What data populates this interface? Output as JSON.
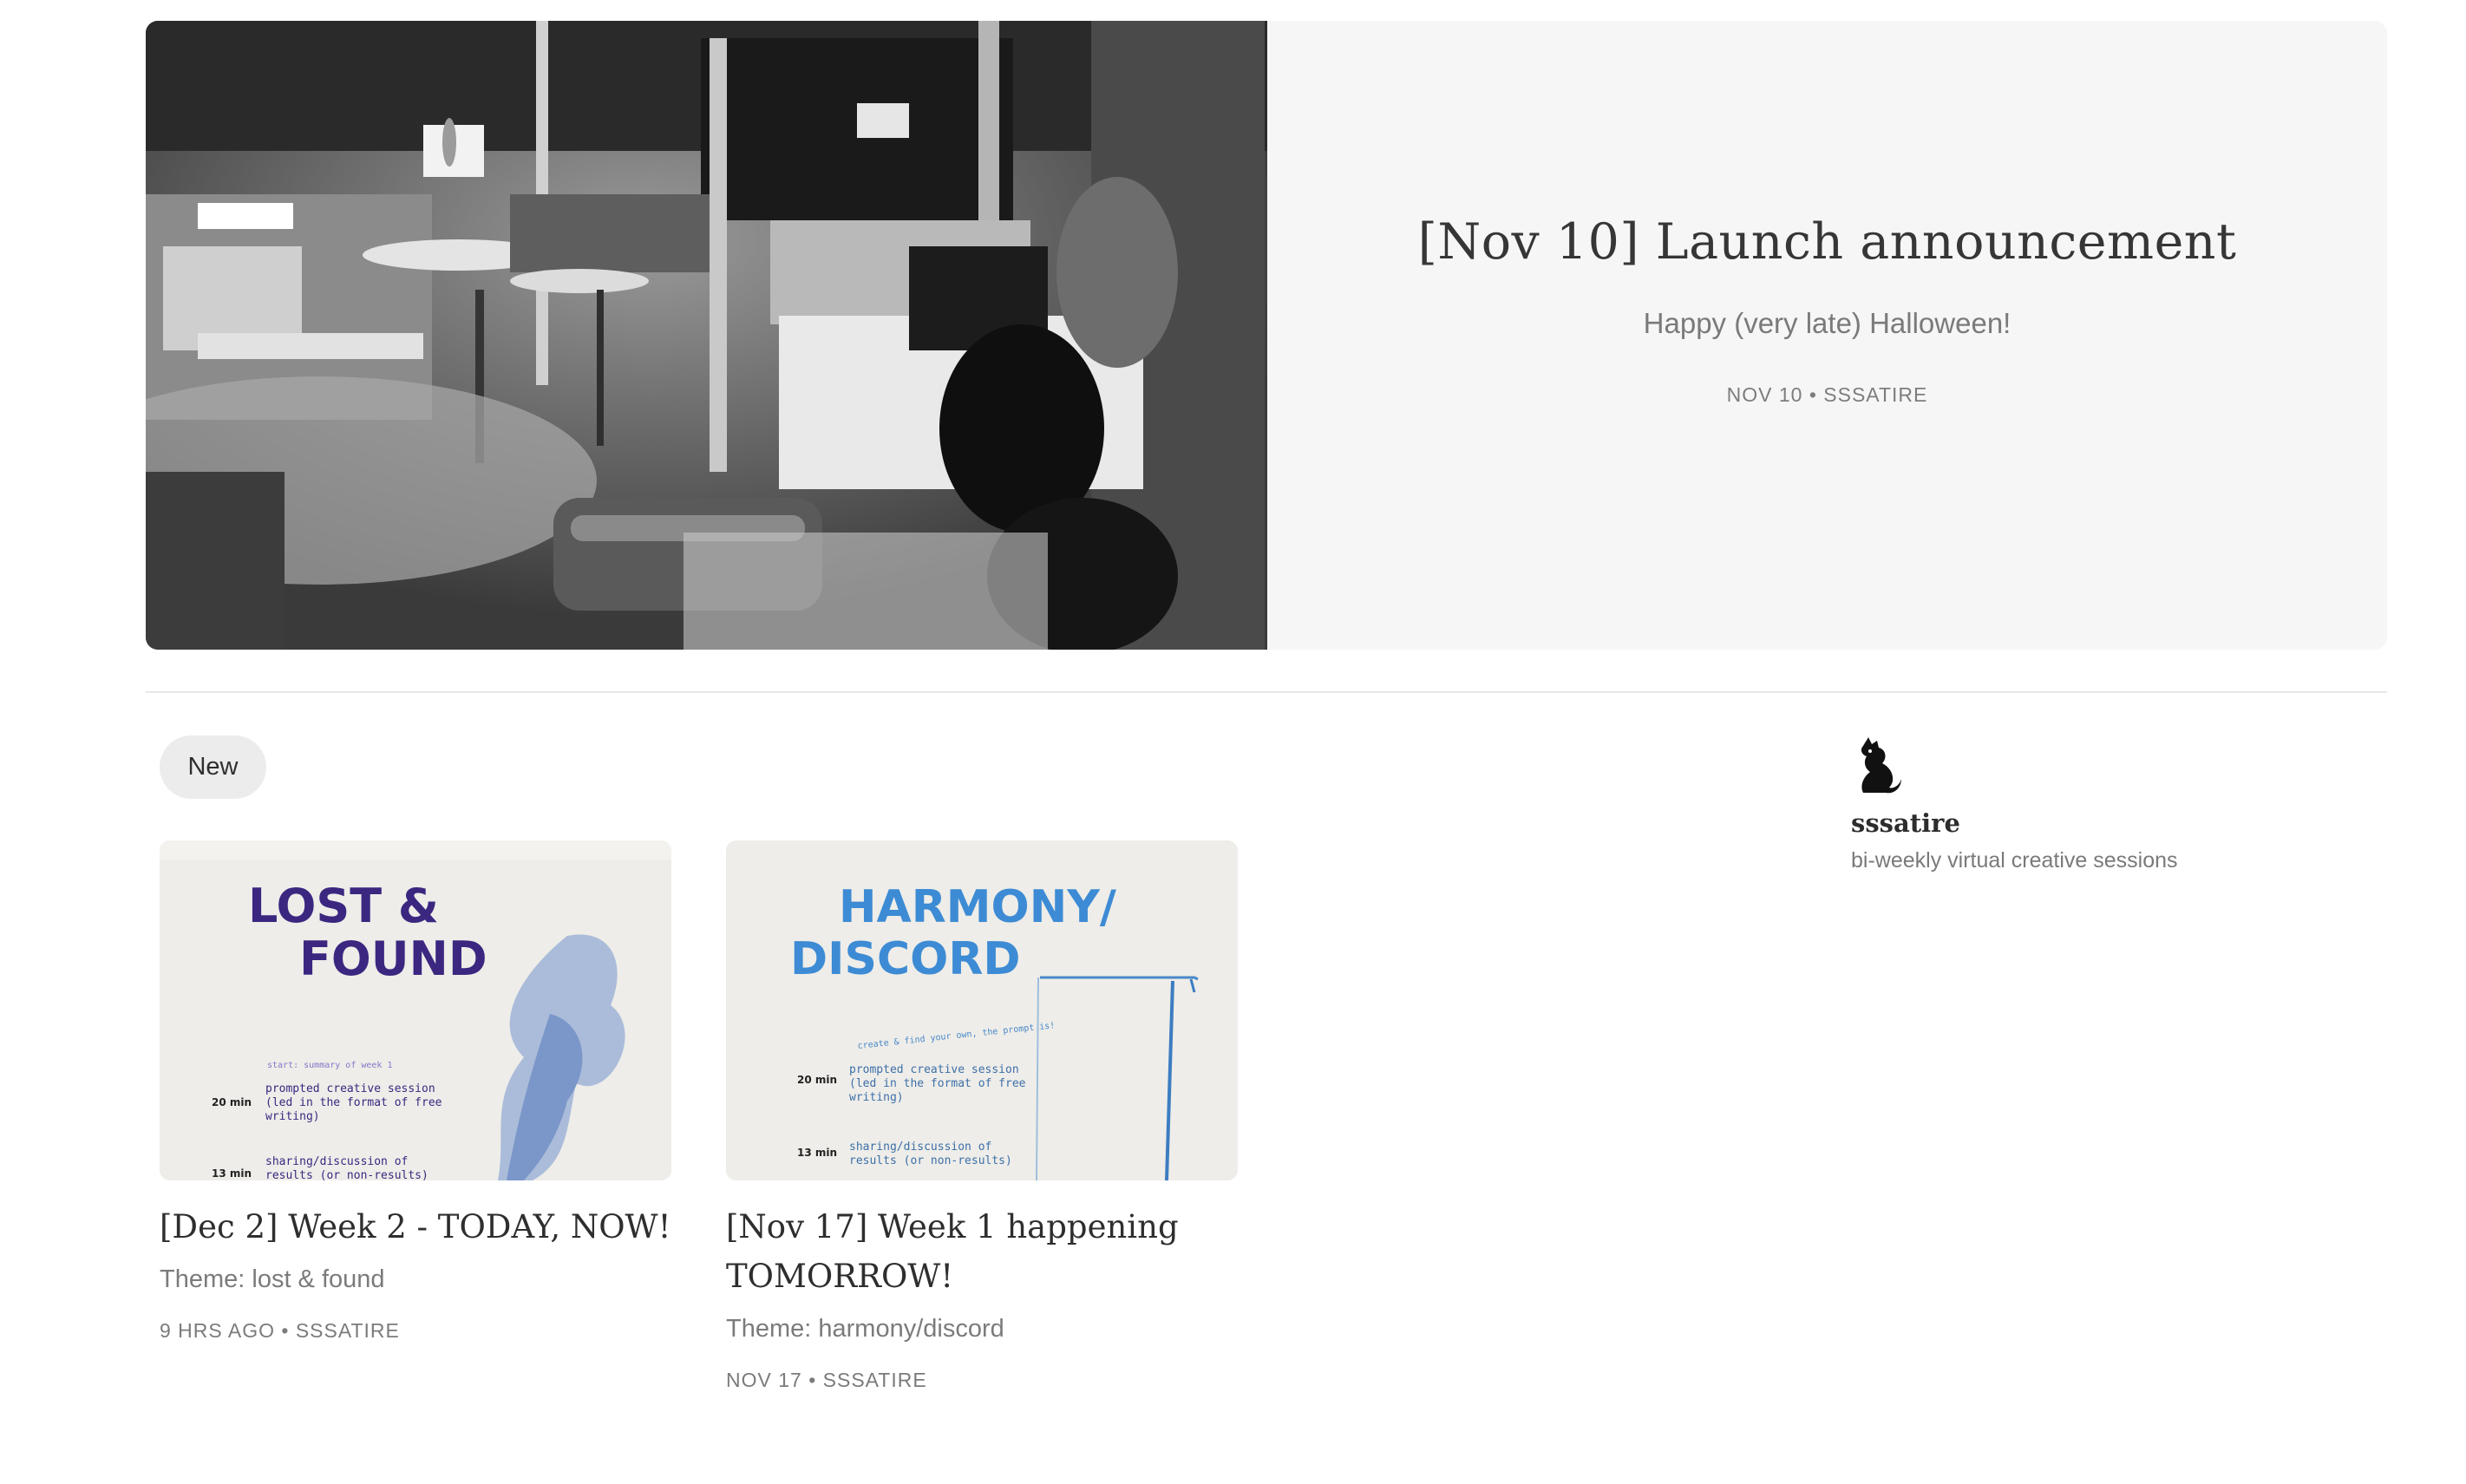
{
  "featured": {
    "title": "[Nov 10] Launch announcement",
    "subtitle": "Happy (very late) Halloween!",
    "meta": "NOV 10 • SSSATIRE",
    "image": "grayscale-painted-cafe-interior-photo"
  },
  "filters": {
    "active_label": "New"
  },
  "posts": [
    {
      "title": "[Dec 2] Week 2 - TODAY, NOW!",
      "subtitle": "Theme: lost & found",
      "meta": "9 HRS AGO • SSSATIRE",
      "thumbnail": {
        "heading_line1": "LOST &",
        "heading_line2": "FOUND",
        "heading_color": "#3b2780",
        "small_note": "start: summary of week 1",
        "rows": [
          {
            "time": "20 min",
            "lines": [
              "prompted creative session",
              "(led in the format of free",
              "writing)"
            ]
          },
          {
            "time": "13 min",
            "lines": [
              "sharing/discussion of",
              "results (or non-results)"
            ]
          }
        ]
      }
    },
    {
      "title": "[Nov 17] Week 1 happening TOMORROW!",
      "subtitle": "Theme: harmony/discord",
      "meta": "NOV 17 • SSSATIRE",
      "thumbnail": {
        "heading_line1": "HARMONY/",
        "heading_line2": "DISCORD",
        "heading_color": "#3d8bd4",
        "small_note": "create & find your own, the prompt is!",
        "rows": [
          {
            "time": "20 min",
            "lines": [
              "prompted creative session",
              "(led in the format of free",
              "writing)"
            ]
          },
          {
            "time": "13 min",
            "lines": [
              "sharing/discussion of",
              "results (or non-results)"
            ]
          }
        ]
      }
    }
  ],
  "publication": {
    "name": "sssatire",
    "description": "bi-weekly virtual creative sessions",
    "avatar_icon": "black-cat-silhouette-icon"
  },
  "colors": {
    "hero_background": "#f6f6f6",
    "pill_background": "#ececec",
    "meta_text": "#7b7b7b"
  }
}
